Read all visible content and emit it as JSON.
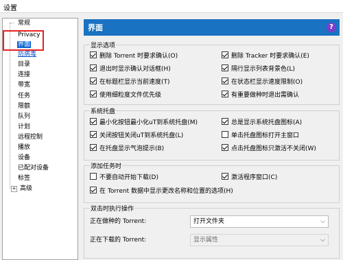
{
  "window": {
    "title": "设置"
  },
  "sidebar": {
    "items": [
      {
        "label": "常规"
      },
      {
        "label": "Privacy"
      },
      {
        "label": "界面"
      },
      {
        "label": "防病毒"
      },
      {
        "label": "目录"
      },
      {
        "label": "连接"
      },
      {
        "label": "带宽"
      },
      {
        "label": "任务"
      },
      {
        "label": "限额"
      },
      {
        "label": "队列"
      },
      {
        "label": "计划"
      },
      {
        "label": "远程控制"
      },
      {
        "label": "播放"
      },
      {
        "label": "设备"
      },
      {
        "label": "已配对设备"
      },
      {
        "label": "标签"
      },
      {
        "label": "高级"
      }
    ],
    "expander_symbol": "+"
  },
  "main": {
    "header_title": "界面",
    "help_icon": "?",
    "groups": {
      "display": {
        "title": "显示选项",
        "items": [
          {
            "label": "删除 Torrent 时要求确认(O)",
            "checked": true
          },
          {
            "label": "删除 Tracker 时要求确认(E)",
            "checked": true
          },
          {
            "label": "退出时显示确认对话框(H)",
            "checked": true
          },
          {
            "label": "隔行显示列表背景色(L)",
            "checked": true
          },
          {
            "label": "在标题栏显示当前速度(T)",
            "checked": true
          },
          {
            "label": "在状态栏显示速度限制(O)",
            "checked": true
          },
          {
            "label": "使用细粒度文件优先级",
            "checked": true
          },
          {
            "label": "有重要做种时退出需确认",
            "checked": true
          }
        ]
      },
      "tray": {
        "title": "系统托盘",
        "items": [
          {
            "label": "最小化按钮最小化uT到系统托盘(M)",
            "checked": true
          },
          {
            "label": "总是显示系统托盘图标(A)",
            "checked": true
          },
          {
            "label": "关闭按钮关闭uT到系统托盘(L)",
            "checked": true
          },
          {
            "label": "单击托盘图标打开主窗口",
            "checked": false
          },
          {
            "label": "在托盘显示气泡提示(B)",
            "checked": true
          },
          {
            "label": "点击托盘图标只激活不关闭(W)",
            "checked": true
          }
        ]
      },
      "add": {
        "title": "添加任务时",
        "items": [
          {
            "label": "不要自动开始下载(D)",
            "checked": false
          },
          {
            "label": "激活程序窗口(C)",
            "checked": true
          },
          {
            "label": "在 Torrent 数据中显示更改名称和位置的选项(H)",
            "checked": true
          }
        ]
      },
      "dblclick": {
        "title": "双击时执行操作",
        "seeding_label": "正在做种的 Torrent:",
        "seeding_value": "打开文件夹",
        "downloading_label": "正在下载的 Torrent:",
        "downloading_value": "显示属性"
      }
    }
  },
  "colors": {
    "header_bg": "#1a72c2",
    "selection": "#0a64d2",
    "highlight": "#e82020"
  }
}
